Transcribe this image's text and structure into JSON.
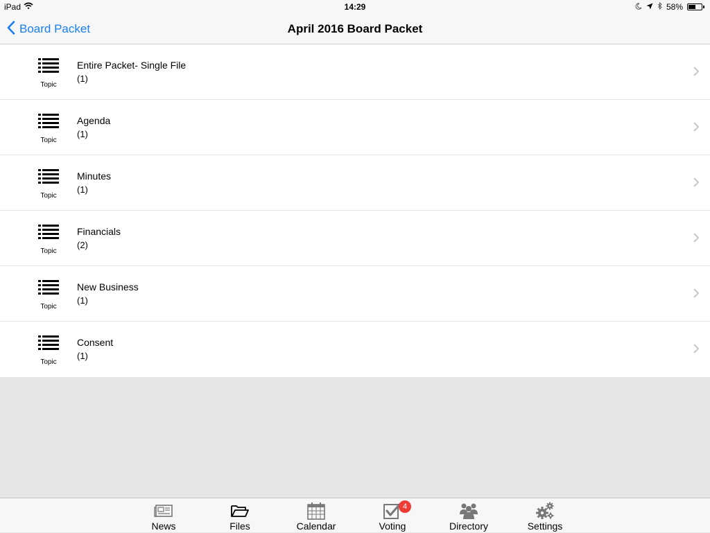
{
  "status_bar": {
    "device": "iPad",
    "time": "14:29",
    "battery": "58%",
    "battery_level": 0.58
  },
  "nav": {
    "back_label": "Board Packet",
    "title": "April 2016 Board Packet"
  },
  "icons": {
    "back": "chevron-left-icon",
    "row": "list-icon",
    "row_chevron": "chevron-right-icon"
  },
  "colors": {
    "accent": "#1a7ff0",
    "badge": "#ef3b36",
    "empty_area": "#e6e6e6"
  },
  "rows": [
    {
      "title": "Entire Packet- Single File",
      "count": "(1)",
      "icon_caption": "Topic"
    },
    {
      "title": "Agenda",
      "count": "(1)",
      "icon_caption": "Topic"
    },
    {
      "title": "Minutes",
      "count": "(1)",
      "icon_caption": "Topic"
    },
    {
      "title": "Financials",
      "count": "(2)",
      "icon_caption": "Topic"
    },
    {
      "title": "New Business",
      "count": "(1)",
      "icon_caption": "Topic"
    },
    {
      "title": "Consent",
      "count": "(1)",
      "icon_caption": "Topic"
    }
  ],
  "tabs": [
    {
      "label": "News",
      "icon": "newspaper-icon"
    },
    {
      "label": "Files",
      "icon": "folder-icon"
    },
    {
      "label": "Calendar",
      "icon": "calendar-icon"
    },
    {
      "label": "Voting",
      "icon": "checkbox-icon",
      "badge": "4"
    },
    {
      "label": "Directory",
      "icon": "people-icon"
    },
    {
      "label": "Settings",
      "icon": "gears-icon"
    }
  ]
}
